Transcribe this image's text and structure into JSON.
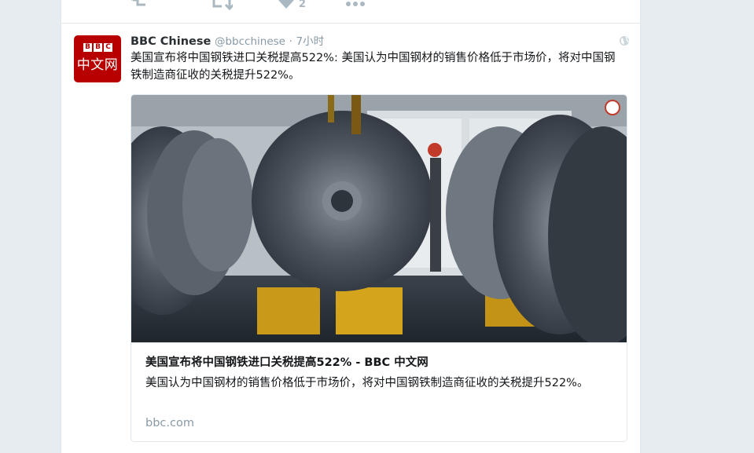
{
  "previous_tweet": {
    "like_count": "2"
  },
  "tweet": {
    "author_name": "BBC Chinese",
    "handle": "@bbcchinese",
    "separator": "·",
    "time": "7小时",
    "text": "美国宣布将中国钢铁进口关税提高522%: 美国认为中国钢材的销售价格低于市场价，将对中国钢铁制造商征收的关税提升522%。",
    "avatar": {
      "logo_letters": [
        "B",
        "B",
        "C"
      ],
      "logo_cn": "中文网"
    }
  },
  "card": {
    "title": "美国宣布将中国钢铁进口关税提高522% - BBC 中文网",
    "description": "美国认为中国钢材的销售价格低于市场价，将对中国钢铁制造商征收的关税提升522%。",
    "domain": "bbc.com"
  },
  "colors": {
    "brand_red": "#b80000",
    "muted": "#8899a6",
    "background": "#e6ecf0"
  },
  "icons": [
    "reply-icon",
    "retweet-icon",
    "like-icon",
    "more-icon",
    "globe-icon"
  ]
}
